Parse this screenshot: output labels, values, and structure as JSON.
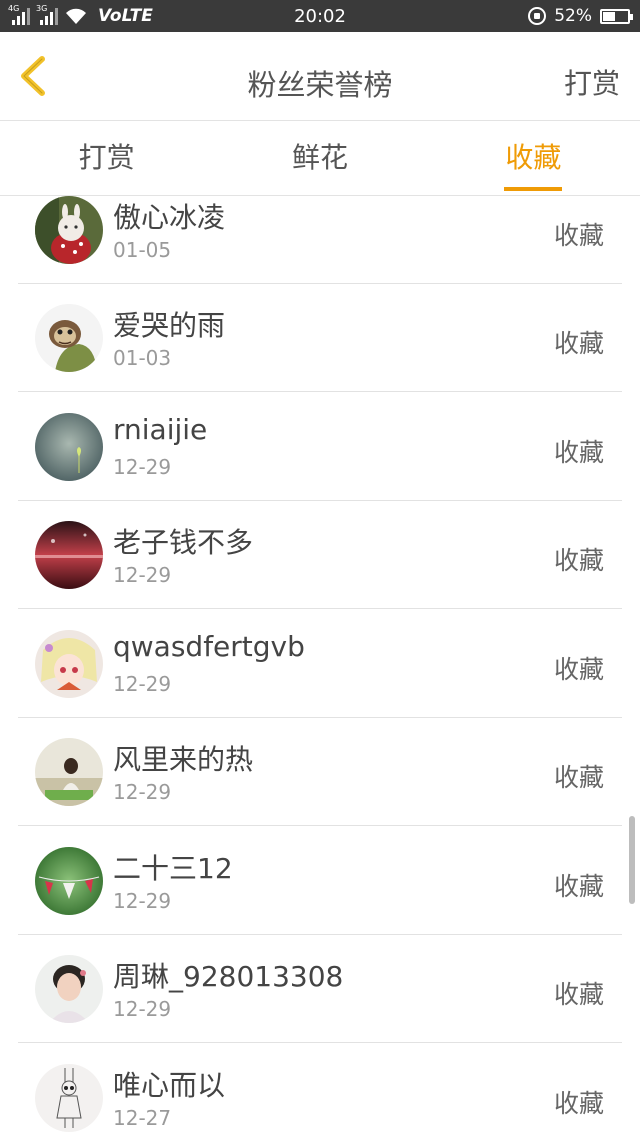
{
  "status_bar": {
    "network_a": "4G",
    "network_b": "3G",
    "volte": "VoLTE",
    "time": "20:02",
    "battery_text": "52%",
    "battery_level": 0.52
  },
  "header": {
    "title": "粉丝荣誉榜",
    "action": "打赏"
  },
  "tabs": [
    {
      "label": "打赏",
      "active": false
    },
    {
      "label": "鲜花",
      "active": false
    },
    {
      "label": "收藏",
      "active": true
    }
  ],
  "list": [
    {
      "name": "傲心冰凌",
      "date": "01-05",
      "type": "收藏"
    },
    {
      "name": "爱哭的雨",
      "date": "01-03",
      "type": "收藏"
    },
    {
      "name": "rniaijie",
      "date": "12-29",
      "type": "收藏"
    },
    {
      "name": "老子钱不多",
      "date": "12-29",
      "type": "收藏"
    },
    {
      "name": "qwasdfertgvb",
      "date": "12-29",
      "type": "收藏"
    },
    {
      "name": "风里来的热",
      "date": "12-29",
      "type": "收藏"
    },
    {
      "name": "二十三12",
      "date": "12-29",
      "type": "收藏"
    },
    {
      "name": "周琳_928013308",
      "date": "12-29",
      "type": "收藏"
    },
    {
      "name": "唯心而以",
      "date": "12-27",
      "type": "收藏"
    }
  ],
  "colors": {
    "accent": "#ef9b06",
    "back_arrow": "#f2c22a",
    "status_bar": "#3a3a3a"
  }
}
